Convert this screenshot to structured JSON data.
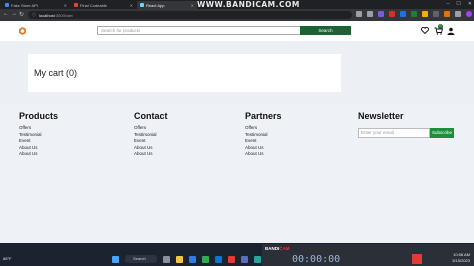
{
  "browser": {
    "tabs": [
      {
        "label": "Fake Store API",
        "active": false
      },
      {
        "label": "Final Codeable",
        "active": false
      },
      {
        "label": "React App",
        "active": true
      }
    ],
    "url_host": "localhost",
    "url_path": ":3000/cart",
    "recording_watermark": "WWW.BANDICAM.COM"
  },
  "header": {
    "search_placeholder": "Search for products",
    "search_button": "Search",
    "cart_count": "0"
  },
  "cart": {
    "title": "My cart (0)"
  },
  "footer": {
    "products": {
      "title": "Products",
      "links": [
        "Offers",
        "Testimonial",
        "Event",
        "About Us",
        "About Us"
      ]
    },
    "contact": {
      "title": "Contact",
      "links": [
        "Offers",
        "Testimonial",
        "Event",
        "About Us",
        "About Us"
      ]
    },
    "partners": {
      "title": "Partners",
      "links": [
        "Offers",
        "Testimonial",
        "Event",
        "About Us",
        "About Us"
      ]
    },
    "newsletter": {
      "title": "Newsletter",
      "email_placeholder": "Enter your email",
      "button": "Subscribe"
    }
  },
  "taskbar": {
    "weather": "88°F",
    "search_label": "Search",
    "time": "10:58 AM",
    "date": "3/15/2023"
  },
  "recorder": {
    "timer": "00:00:00"
  },
  "colors": {
    "brand_green": "#1b6333",
    "subscribe_green": "#1b8f3a",
    "page_bg": "#eceff4"
  }
}
